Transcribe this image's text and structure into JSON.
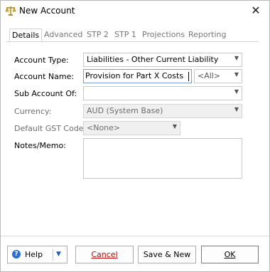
{
  "window": {
    "title": "New Account",
    "close_glyph": "✕"
  },
  "tabs": [
    {
      "label": "Details",
      "active": true
    },
    {
      "label": "Advanced"
    },
    {
      "label": "STP 2"
    },
    {
      "label": "STP 1"
    },
    {
      "label": "Projections"
    },
    {
      "label": "Reporting"
    }
  ],
  "form": {
    "account_type": {
      "label": "Account Type:",
      "value": "Liabilities - Other Current Liability"
    },
    "account_name": {
      "label": "Account Name:",
      "value": "Provision for Part X Costs",
      "scope": "<All>"
    },
    "sub_account_of": {
      "label": "Sub Account Of:",
      "value": ""
    },
    "currency": {
      "label": "Currency:",
      "value": "AUD (System Base)"
    },
    "default_gst_code": {
      "label": "Default GST Code:",
      "value": "<None>"
    },
    "notes": {
      "label": "Notes/Memo:",
      "value": ""
    }
  },
  "buttons": {
    "help": "Help",
    "help_glyph": "?",
    "help_dropdown_glyph": "▼",
    "cancel": "Cancel",
    "save_new": "Save & New",
    "ok": "OK"
  },
  "icons": {
    "dropdown_glyph": "▼"
  },
  "colors": {
    "cancel_text": "#c00000",
    "help_icon": "#2a6fd6",
    "input_focus_border": "#7a9ed6"
  }
}
